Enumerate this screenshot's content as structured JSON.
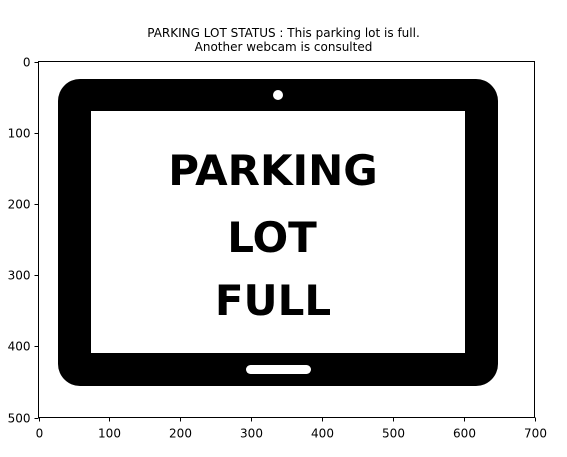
{
  "figure": {
    "title_line1": "PARKING LOT STATUS : This parking lot is full.",
    "title_line2": "Another webcam is consulted"
  },
  "image": {
    "sign_lines": [
      "PARKING",
      "LOT",
      "FULL"
    ],
    "description_icon": "tablet-icon"
  },
  "axes": {
    "x_ticks": [
      0,
      100,
      200,
      300,
      400,
      500,
      600,
      700
    ],
    "y_ticks": [
      0,
      100,
      200,
      300,
      400,
      500
    ],
    "xlim": [
      0,
      700
    ],
    "ylim": [
      500,
      0
    ]
  },
  "colors": {
    "foreground": "#000000",
    "background": "#ffffff"
  }
}
